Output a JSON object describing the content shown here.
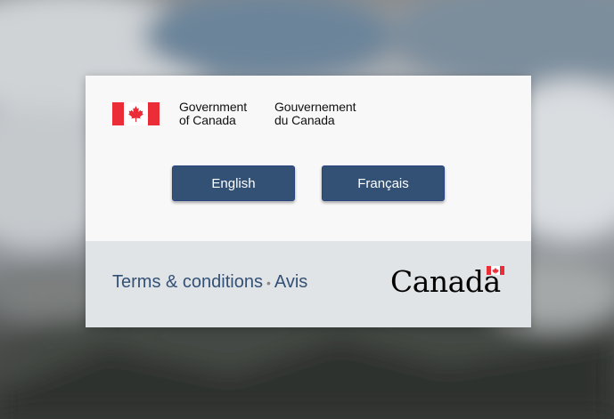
{
  "signature": {
    "en_line1": "Government",
    "en_line2": "of Canada",
    "fr_line1": "Gouvernement",
    "fr_line2": "du Canada"
  },
  "language_buttons": {
    "english": "English",
    "francais": "Français"
  },
  "footer": {
    "terms_label": "Terms & conditions",
    "separator": "•",
    "avis_label": "Avis",
    "wordmark": "Canada"
  },
  "colors": {
    "flag_red": "#eb2d37",
    "button_blue": "#335075",
    "card_top": "#f8f8f8",
    "card_bottom": "#e1e4e7"
  }
}
